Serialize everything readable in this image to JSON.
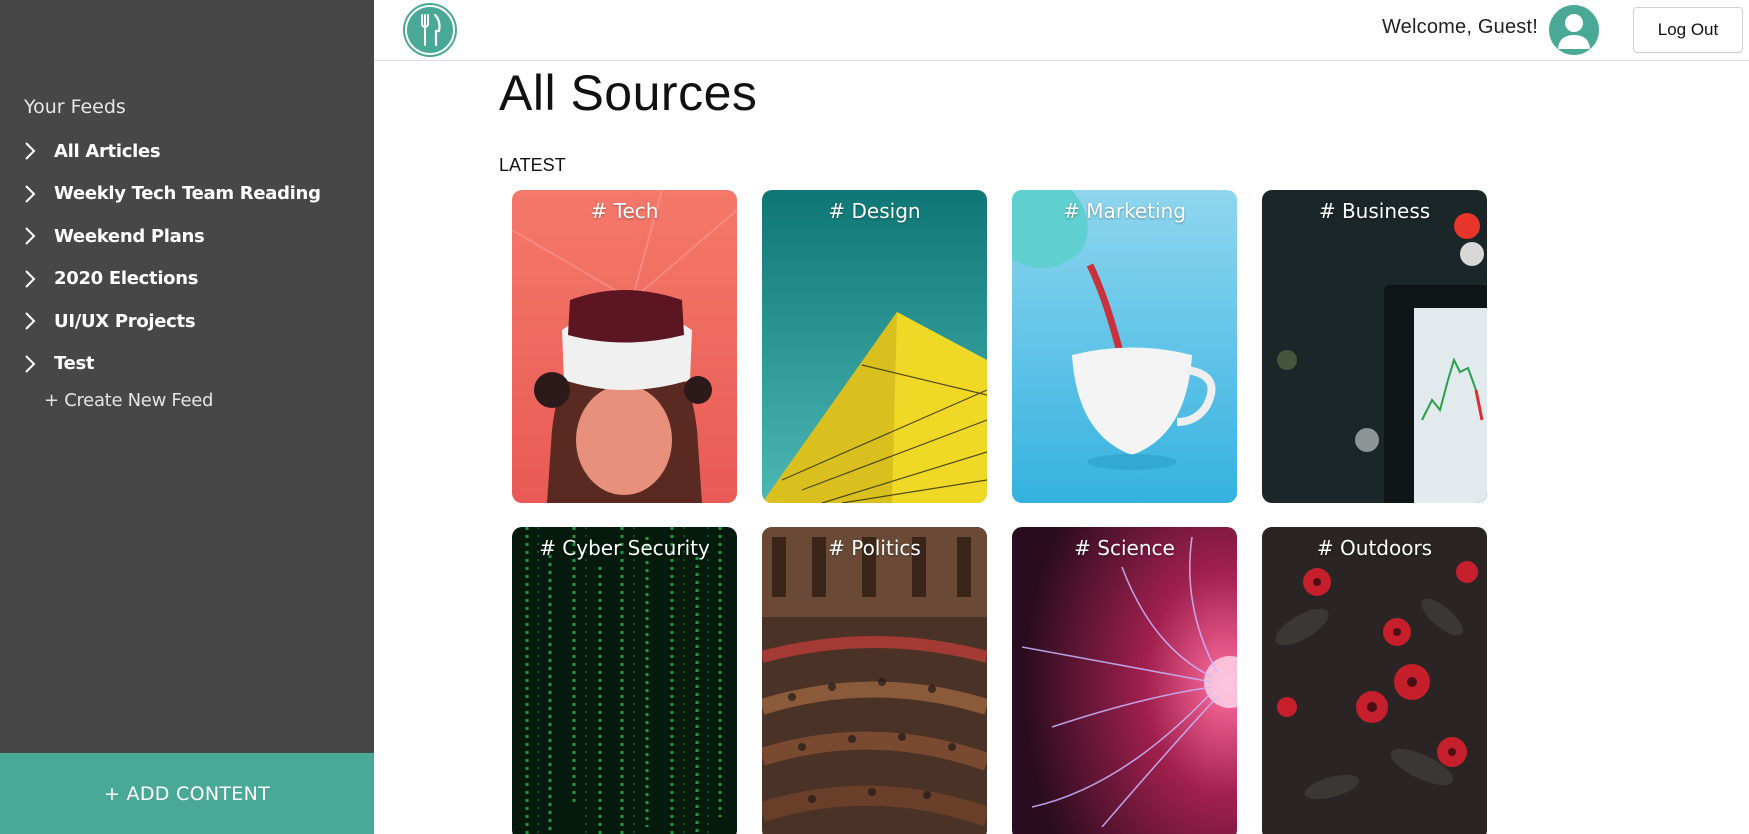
{
  "sidebar": {
    "title": "Your Feeds",
    "items": [
      {
        "label": "All Articles"
      },
      {
        "label": "Weekly Tech Team Reading"
      },
      {
        "label": "Weekend Plans"
      },
      {
        "label": "2020 Elections"
      },
      {
        "label": "UI/UX Projects"
      },
      {
        "label": "Test"
      }
    ],
    "create_label": "+ Create New Feed",
    "add_content_label": "+ ADD CONTENT"
  },
  "header": {
    "logo_icon": "fork-knife-icon",
    "welcome": "Welcome, Guest!",
    "avatar_icon": "user-avatar-icon",
    "logout_label": "Log Out"
  },
  "main": {
    "title": "All Sources",
    "section_label": "LATEST",
    "cards": [
      {
        "tag": "# Tech"
      },
      {
        "tag": "# Design"
      },
      {
        "tag": "# Marketing"
      },
      {
        "tag": "# Business"
      },
      {
        "tag": "# Cyber Security"
      },
      {
        "tag": "# Politics"
      },
      {
        "tag": "# Science"
      },
      {
        "tag": "# Outdoors"
      }
    ]
  },
  "colors": {
    "sidebar_bg": "#474747",
    "accent": "#4aa896"
  }
}
